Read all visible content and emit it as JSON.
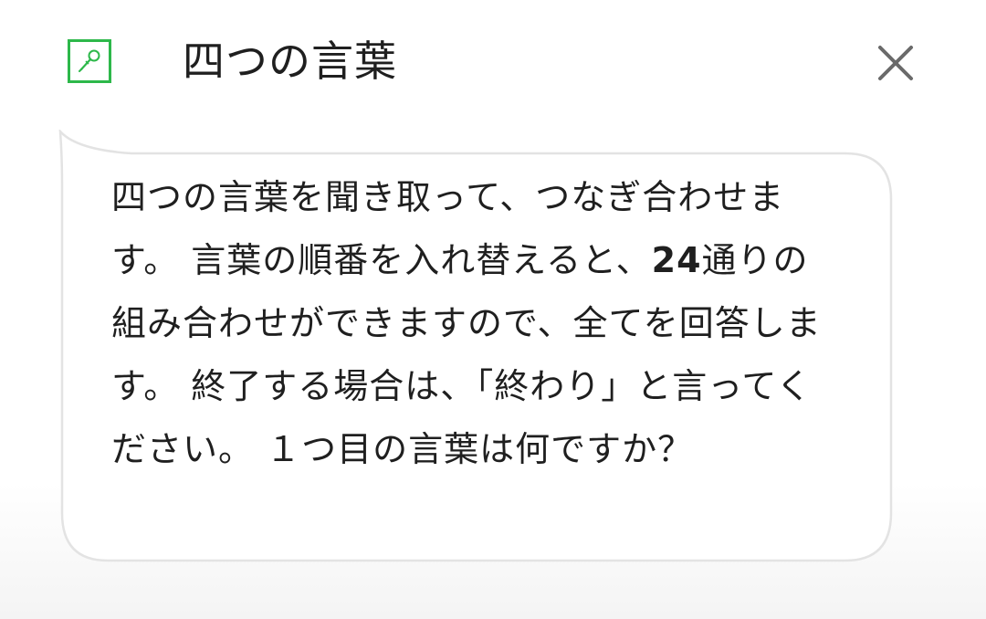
{
  "header": {
    "icon": "microphone-icon",
    "title": "四つの言葉",
    "close_icon": "close-icon"
  },
  "message": {
    "part1": "四つの言葉を聞き取って、つなぎ合わせます。 言葉の順番を入れ替えると、",
    "count": "24",
    "part2": "通りの組み合わせができますので、全てを回答します。 終了する場合は、「終わり」と言ってください。 １つ目の言葉は何ですか？"
  },
  "colors": {
    "icon_border": "#2db84a",
    "bubble_border": "#e3e3e3",
    "text": "#1f1f1f"
  }
}
